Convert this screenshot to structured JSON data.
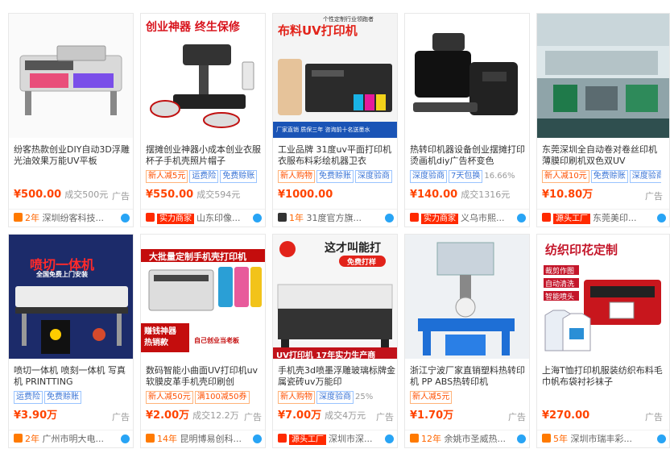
{
  "cards": [
    {
      "title": "纷客热款创业DIY自动3D浮雕光油效果万能UV平板",
      "badges": [],
      "price": "¥500.00",
      "sold": "成交500元",
      "ad": "广告",
      "shop_year": "2年",
      "shop_name": "深圳纷客科技..."
    },
    {
      "image_texts": [
        "创业神器 终生保修"
      ],
      "title": "摆摊创业神器小成本创业衣服杯子手机壳照片帽子",
      "badges": [
        "新人减5元",
        "运费险",
        "免费赊账"
      ],
      "price": "¥550.00",
      "sold": "成交594元",
      "ad": "",
      "shop_tag": "实力商家",
      "shop_name": "山东印像..."
    },
    {
      "image_texts": [
        "布料UV打印机",
        "个性定制行业领跑者",
        "厂家直销 质保三年 咨询前十名送墨水"
      ],
      "title": "工业品牌 31度uv平面打印机衣服布料彩绘机器卫衣",
      "badges": [
        "新人购物",
        "免费赊账",
        "深度验商"
      ],
      "price": "¥1000.00",
      "sold": "",
      "ad": "",
      "shop_year": "1年",
      "shop_name": "31度官方旗..."
    },
    {
      "title": "热转印机器设备创业摆摊打印烫画机diy广告杯变色",
      "badges": [
        "深度验商",
        "7天包换"
      ],
      "badge_extra": "16.66%",
      "price": "¥140.00",
      "sold": "成交1316元",
      "ad": "",
      "shop_tag": "实力商家",
      "shop_name": "义乌市熙..."
    },
    {
      "title": "东莞深圳全自动卷对卷丝印机薄膜印刷机双色双UV",
      "badges": [
        "新人减10元",
        "免费赊账",
        "深度验商"
      ],
      "price": "¥10.80万",
      "sold": "",
      "ad": "广告",
      "shop_tag": "源头工厂",
      "shop_name": "东莞美印..."
    },
    {
      "image_texts": [
        "喷切一体机",
        "全国免费上门安装"
      ],
      "title": "喷切一体机 喷刻一体机 写真机 PRINTTING",
      "badges": [
        "运费险",
        "免费赊账"
      ],
      "price": "¥3.90万",
      "sold": "",
      "ad": "广告",
      "shop_year": "2年",
      "shop_name": "广州市明大电..."
    },
    {
      "image_texts": [
        "大批量定制手机壳打印机",
        "赚钱神器 热销款",
        "自己创业当老板"
      ],
      "title": "数码智能小曲面UV打印机uv软膜皮革手机壳印刷创",
      "badges": [
        "新人减50元",
        "满100减50券"
      ],
      "price": "¥2.00万",
      "sold": "成交12.2万",
      "ad": "广告",
      "shop_year": "14年",
      "shop_name": "昆明博易创科..."
    },
    {
      "image_texts": [
        "这才叫能打",
        "免费打样",
        "UV打印机 17年实力生产商"
      ],
      "title": "手机壳3d喷墨浮雕玻璃标牌金属瓷砖uv万能印",
      "badges": [
        "新人购物",
        "深度验商"
      ],
      "badge_extra": "25%",
      "price": "¥7.00万",
      "sold": "成交4万元",
      "ad": "广告",
      "shop_tag": "源头工厂",
      "shop_name": "深圳市深..."
    },
    {
      "title": "浙江宁波厂家直销塑料热转印机 PP ABS热转印机",
      "badges": [
        "新人减5元"
      ],
      "price": "¥1.70万",
      "sold": "",
      "ad": "广告",
      "shop_year": "12年",
      "shop_name": "余姚市圣威热..."
    },
    {
      "image_texts": [
        "纺织印花定制",
        "裁剪作图",
        "自动清洗",
        "智能喷头"
      ],
      "title": "上海T恤打印机服装纺织布料毛巾帆布袋衬衫袜子",
      "badges": [],
      "price": "¥270.00",
      "sold": "",
      "ad": "广告",
      "shop_year": "5年",
      "shop_name": "深圳市瑞丰彩..."
    }
  ]
}
